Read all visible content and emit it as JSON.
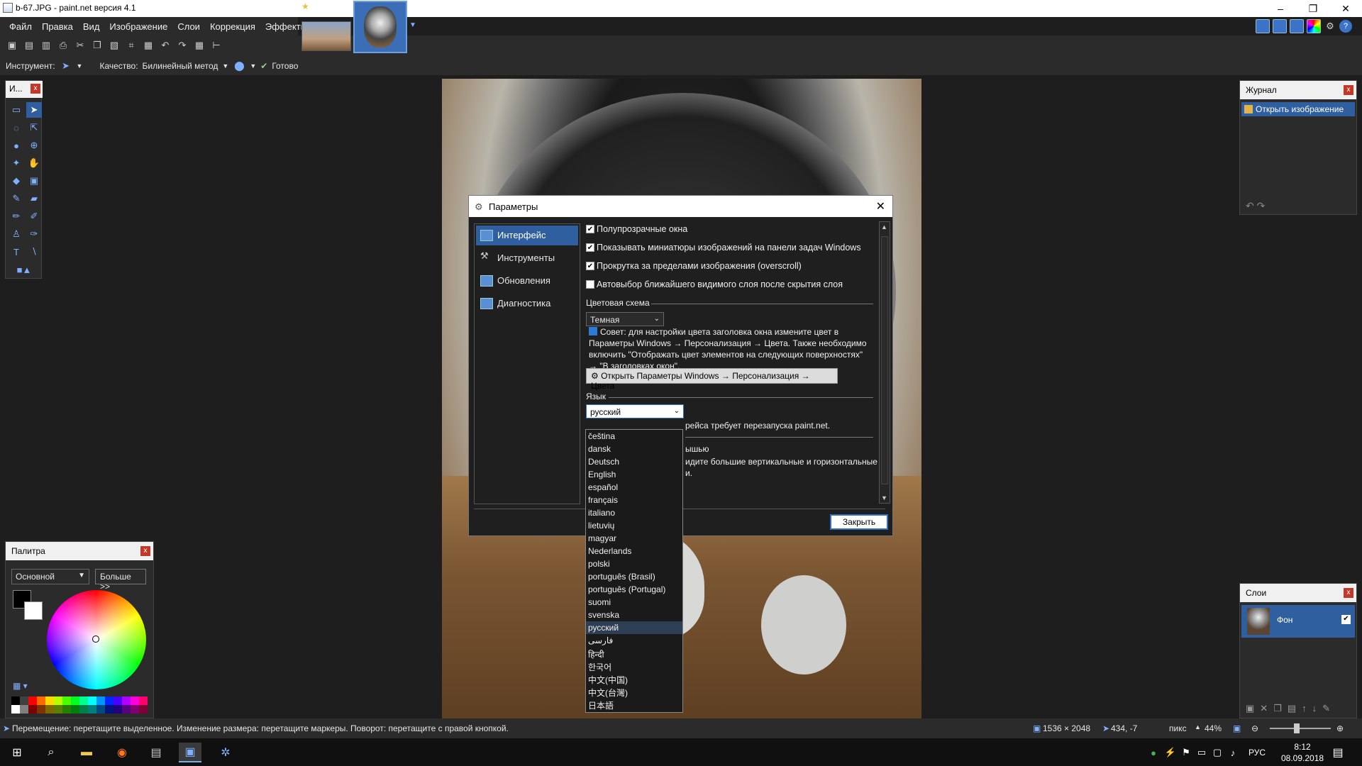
{
  "window": {
    "title": "b-67.JPG - paint.net версия 4.1"
  },
  "menu": [
    "Файл",
    "Правка",
    "Вид",
    "Изображение",
    "Слои",
    "Коррекция",
    "Эффекты"
  ],
  "toolbar2": {
    "tool_label": "Инструмент:",
    "quality_label": "Качество:",
    "quality_value": "Билинейный метод",
    "finish_label": "Готово"
  },
  "tools_panel": {
    "title": "И..."
  },
  "palette": {
    "title": "Палитра",
    "mode": "Основной",
    "more_button": "Больше >>",
    "primary_color": "#000000",
    "secondary_color": "#ffffff"
  },
  "history": {
    "title": "Журнал",
    "items": [
      "Открыть изображение"
    ]
  },
  "layers": {
    "title": "Слои",
    "items": [
      {
        "name": "Фон",
        "visible": true
      }
    ]
  },
  "dialog": {
    "title": "Параметры",
    "nav": [
      "Интерфейс",
      "Инструменты",
      "Обновления",
      "Диагностика"
    ],
    "checkboxes": [
      {
        "label": "Полупрозрачные окна",
        "checked": true
      },
      {
        "label": "Показывать миниатюры изображений на панели задач Windows",
        "checked": true
      },
      {
        "label": "Прокрутка за пределами изображения (overscroll)",
        "checked": true
      },
      {
        "label": "Автовыбор ближайшего видимого слоя после скрытия слоя",
        "checked": false
      }
    ],
    "color_scheme_label": "Цветовая схема",
    "color_scheme_value": "Темная",
    "tip": "Совет: для настройки цвета заголовка окна измените цвет в Параметры Windows → Персонализация → Цвета. Также необходимо включить \"Отображать цвет элементов на следующих поверхностях\" → \"В заголовках окон\".",
    "open_settings_button": "Открыть Параметры Windows → Персонализация → Цвета",
    "language_label": "Язык",
    "language_value": "русский",
    "language_note_tail": "рейса требует перезапуска paint.net.",
    "partial_line1": "ышью",
    "partial_line2": "идите большие вертикальные и горизонтальные",
    "partial_line3": "и.",
    "close_button": "Закрыть"
  },
  "languages": [
    "čeština",
    "dansk",
    "Deutsch",
    "English",
    "español",
    "français",
    "italiano",
    "lietuvių",
    "magyar",
    "Nederlands",
    "polski",
    "português (Brasil)",
    "português (Portugal)",
    "suomi",
    "svenska",
    "русский",
    "فارسی",
    "हिन्दी",
    "한국어",
    "中文(中国)",
    "中文(台灣)",
    "日本語"
  ],
  "status": {
    "hint": "Перемещение: перетащите выделенное. Изменение размера: перетащите маркеры. Поворот: перетащите с правой кнопкой.",
    "size": "1536 × 2048",
    "coords": "434, -7",
    "units": "пикс",
    "zoom": "44%",
    "zoom_fraction": 0.44
  },
  "taskbar": {
    "lang": "РУС",
    "time": "8:12",
    "date": "08.09.2018"
  }
}
